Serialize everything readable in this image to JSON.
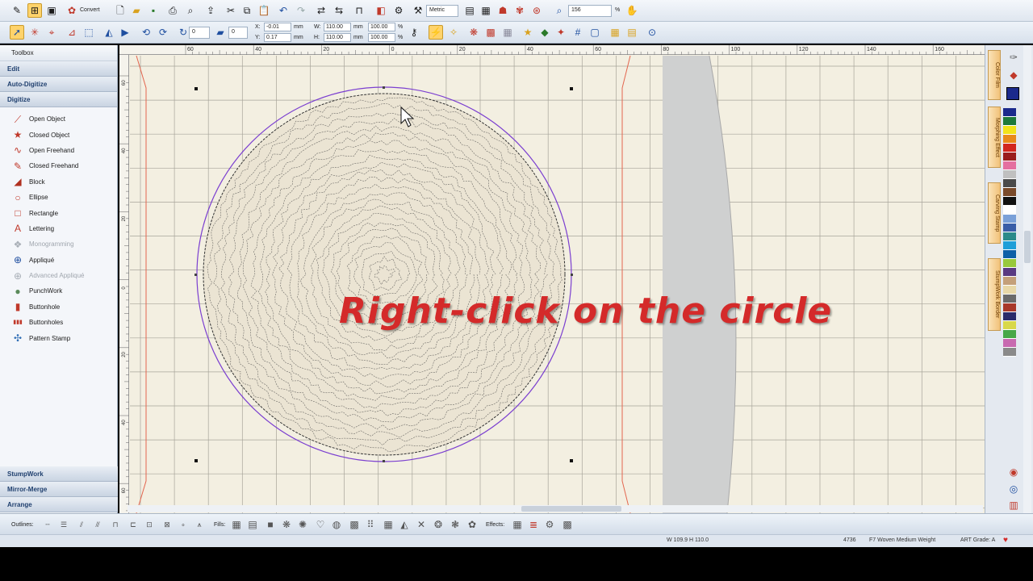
{
  "toolbar": {
    "convert_label": "Convert",
    "units": "Metric",
    "zoom": "156",
    "zoom_unit": "%",
    "rotate_value": "0",
    "slant_value": "0",
    "x_label": "X:",
    "x_value": "-0.01",
    "y_label": "Y:",
    "y_value": "0.17",
    "unit_mm": "mm",
    "w_label": "W:",
    "w_value": "110.00",
    "h_label": "H:",
    "h_value": "110.00",
    "w_percent": "100.00",
    "h_percent": "100.00",
    "pct": "%"
  },
  "toolbox": {
    "title": "Toolbox",
    "sections_top": [
      "Edit",
      "Auto-Digitize",
      "Digitize"
    ],
    "items": [
      {
        "label": "Open Object",
        "icon": "open-object-icon",
        "glyph": "⟋",
        "color": "#c0392b",
        "enabled": true
      },
      {
        "label": "Closed Object",
        "icon": "closed-object-icon",
        "glyph": "★",
        "color": "#c0392b",
        "enabled": true
      },
      {
        "label": "Open Freehand",
        "icon": "open-freehand-icon",
        "glyph": "∿",
        "color": "#c0392b",
        "enabled": true
      },
      {
        "label": "Closed Freehand",
        "icon": "closed-freehand-icon",
        "glyph": "✎",
        "color": "#c0392b",
        "enabled": true
      },
      {
        "label": "Block",
        "icon": "block-icon",
        "glyph": "◢",
        "color": "#b03020",
        "enabled": true
      },
      {
        "label": "Ellipse",
        "icon": "ellipse-icon",
        "glyph": "○",
        "color": "#c0392b",
        "enabled": true
      },
      {
        "label": "Rectangle",
        "icon": "rectangle-icon",
        "glyph": "□",
        "color": "#c0392b",
        "enabled": true
      },
      {
        "label": "Lettering",
        "icon": "lettering-icon",
        "glyph": "A",
        "color": "#c0392b",
        "enabled": true
      },
      {
        "label": "Monogramming",
        "icon": "monogramming-icon",
        "glyph": "❖",
        "color": "#a8aeb6",
        "enabled": false
      },
      {
        "label": "Appliqué",
        "icon": "applique-icon",
        "glyph": "⊕",
        "color": "#1f4fa0",
        "enabled": true
      },
      {
        "label": "Advanced Appliqué",
        "icon": "advanced-applique-icon",
        "glyph": "⊕",
        "color": "#a8aeb6",
        "enabled": false
      },
      {
        "label": "PunchWork",
        "icon": "punchwork-icon",
        "glyph": "●",
        "color": "#5a8a5a",
        "enabled": true
      },
      {
        "label": "Buttonhole",
        "icon": "buttonhole-icon",
        "glyph": "▮",
        "color": "#c0392b",
        "enabled": true
      },
      {
        "label": "Buttonholes",
        "icon": "buttonholes-icon",
        "glyph": "▮▮▮",
        "color": "#c0392b",
        "enabled": true
      },
      {
        "label": "Pattern Stamp",
        "icon": "pattern-stamp-icon",
        "glyph": "✣",
        "color": "#2e6db5",
        "enabled": true
      }
    ],
    "sections_bottom": [
      "StumpWork",
      "Mirror-Merge",
      "Arrange"
    ]
  },
  "ruler": {
    "top_labels": [
      "60",
      "40",
      "20",
      "0",
      "20",
      "40",
      "60",
      "80",
      "100",
      "120",
      "140",
      "160"
    ],
    "left_labels": [
      "60",
      "40",
      "20",
      "0",
      "20",
      "40",
      "60"
    ]
  },
  "right_tabs": [
    "Color Film",
    "Morphing Effect",
    "Carving Stamp",
    "StumpWork Border"
  ],
  "palette": [
    "#1b2a8c",
    "#1f7a3a",
    "#f2e31a",
    "#e88a1a",
    "#d2261e",
    "#9a1d1d",
    "#e46fa0",
    "#c0c0c0",
    "#4a4a4a",
    "#7a4a2a",
    "#111111",
    "#ffffff",
    "#7aa0d8",
    "#3a5ea8",
    "#2a8a8a",
    "#1e9ed8",
    "#0d5fa8",
    "#98c93c",
    "#5a3a82",
    "#c4a07a",
    "#e8d8a8",
    "#6a6a6a",
    "#a8382a",
    "#2a2a6a",
    "#d8d84a",
    "#48a848",
    "#c86ab0",
    "#8a8a8a"
  ],
  "status": {
    "outlines_label": "Outlines:",
    "fills_label": "Fills:",
    "effects_label": "Effects:",
    "dimensions": "W 109.9 H 110.0",
    "stitch_count": "4736",
    "fabric": "F7 Woven Medium Weight",
    "art_grade": "ART Grade: A"
  },
  "caption": "Right-click on the circle"
}
